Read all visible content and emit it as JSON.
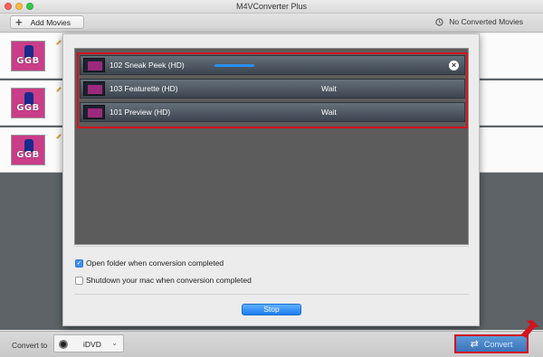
{
  "window": {
    "title": "M4VConverter Plus"
  },
  "toolbar": {
    "add_label": "Add Movies",
    "no_converted_label": "No Converted Movies"
  },
  "movies": [
    {
      "thumb_text": "GGB"
    },
    {
      "thumb_text": "GGB"
    },
    {
      "thumb_text": "GGB"
    }
  ],
  "dialog": {
    "tasks": [
      {
        "title": "102 Sneak Peek (HD)",
        "status": "",
        "progress": 0.4
      },
      {
        "title": "103 Featurette (HD)",
        "status": "Wait"
      },
      {
        "title": "101 Preview (HD)",
        "status": "Wait"
      }
    ],
    "open_folder_label": "Open folder when conversion completed",
    "open_folder_checked": true,
    "shutdown_label": "Shutdown your mac when conversion completed",
    "shutdown_checked": false,
    "stop_label": "Stop"
  },
  "bottom": {
    "convert_to_label": "Convert to",
    "format_value": "iDVD",
    "convert_button_label": "Convert"
  },
  "colors": {
    "highlight": "#d2141e",
    "accent": "#2a8ff0",
    "light_red": "#fc605b",
    "light_yellow": "#fdbc40",
    "light_green": "#34c84a"
  },
  "icons": {
    "add": "plus-icon",
    "history": "clock-icon",
    "cancel": "close-circle-icon",
    "format": "disc-icon",
    "convert": "sync-icon"
  }
}
